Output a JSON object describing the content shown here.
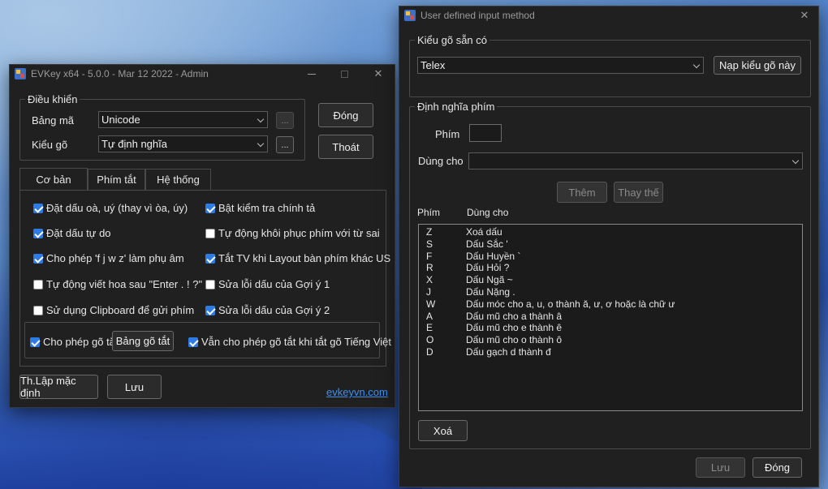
{
  "evkey": {
    "title": "EVKey x64 - 5.0.0 - Mar 12 2022 - Admin",
    "control_group": "Điều khiển",
    "charset_label": "Bảng mã",
    "charset_value": "Unicode",
    "input_label": "Kiểu gõ",
    "input_value": "Tự định nghĩa",
    "dots": "...",
    "close_btn": "Đóng",
    "exit_btn": "Thoát",
    "tabs": [
      "Cơ bản",
      "Phím tắt",
      "Hệ thống"
    ],
    "options": [
      {
        "label": "Đặt dấu oà, uý (thay vì òa, úy)",
        "checked": true
      },
      {
        "label": "Bật kiểm tra chính tả",
        "checked": true
      },
      {
        "label": "Đặt dấu tự do",
        "checked": true
      },
      {
        "label": "Tự động khôi phục phím với từ sai",
        "checked": false
      },
      {
        "label": "Cho phép 'f j w z' làm phụ âm",
        "checked": true
      },
      {
        "label": "Tắt TV khi Layout bàn phím khác US",
        "checked": true
      },
      {
        "label": "Tự động viết hoa sau \"Enter . ! ?\"",
        "checked": false
      },
      {
        "label": "Sửa lỗi dấu của Gợi ý 1",
        "checked": false
      },
      {
        "label": "Sử dụng Clipboard để gửi phím",
        "checked": false
      },
      {
        "label": "Sửa lỗi dấu của Gợi ý 2",
        "checked": true
      }
    ],
    "shortcut_allow": "Cho phép gõ tắt",
    "shortcut_table_btn": "Bảng gõ tắt",
    "shortcut_keep": "Vẫn cho phép gõ tắt khi tắt gõ Tiếng Việt",
    "defaults_btn": "Th.Lập mặc định",
    "save_btn": "Lưu",
    "link": "evkeyvn.com"
  },
  "udim": {
    "title": "User defined input method",
    "preset_group": "Kiểu gõ sẵn có",
    "preset_value": "Telex",
    "load_btn": "Nạp kiểu gõ này",
    "define_group": "Định nghĩa phím",
    "key_label": "Phím",
    "use_label": "Dùng cho",
    "add_btn": "Thêm",
    "replace_btn": "Thay thế",
    "col_key": "Phím",
    "col_use": "Dùng cho",
    "rows": [
      {
        "k": "Z",
        "v": "Xoá dấu"
      },
      {
        "k": "S",
        "v": "Dấu Sắc '"
      },
      {
        "k": "F",
        "v": "Dấu Huyền `"
      },
      {
        "k": "R",
        "v": "Dấu Hỏi ?"
      },
      {
        "k": "X",
        "v": "Dấu Ngã ~"
      },
      {
        "k": "J",
        "v": "Dấu Nặng ."
      },
      {
        "k": "W",
        "v": "Dấu móc cho a, u, o thành ă, ư, ơ hoặc là chữ ư"
      },
      {
        "k": "A",
        "v": "Dấu mũ cho a thành â"
      },
      {
        "k": "E",
        "v": "Dấu mũ cho e thành ê"
      },
      {
        "k": "O",
        "v": "Dấu mũ cho o thành ô"
      },
      {
        "k": "D",
        "v": "Dấu gạch d thành đ"
      }
    ],
    "delete_btn": "Xoá",
    "save_btn": "Lưu",
    "close_btn": "Đóng"
  },
  "colors": {
    "window_bg": "#202020",
    "accent": "#2f7be6",
    "link": "#3d8ef0"
  }
}
